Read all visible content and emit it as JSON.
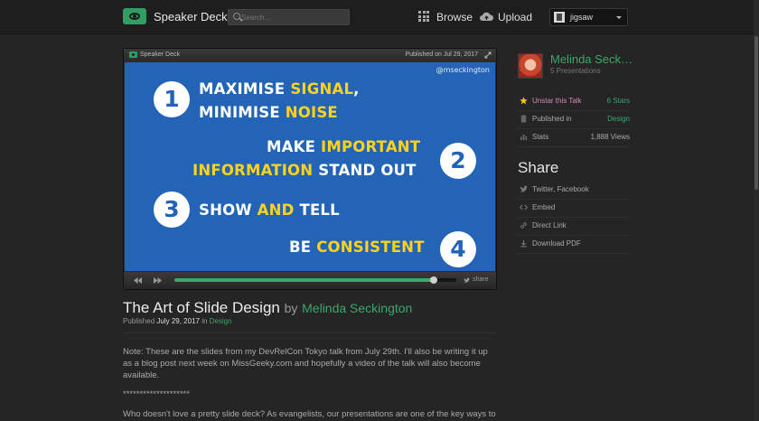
{
  "header": {
    "brand": "Speaker Deck",
    "search_placeholder": "Search...",
    "browse": "Browse",
    "upload": "Upload",
    "username": "jigsaw"
  },
  "player": {
    "brand": "Speaker Deck",
    "published": "Published on Jul 29, 2017",
    "share": "share",
    "progress": 0.92
  },
  "slide": {
    "handle": "@mseckington",
    "num1": "1",
    "line1a": "MAXIMISE ",
    "line1b": "SIGNAL",
    "line1c": ",",
    "line2a": "MINIMISE ",
    "line2b": "NOISE",
    "num2": "2",
    "line3a": "MAKE ",
    "line3b": "IMPORTANT",
    "line4a": "INFORMATION",
    "line4b": " STAND OUT",
    "num3": "3",
    "line5a": "SHOW ",
    "line5b": "AND",
    "line5c": " TELL",
    "num4": "4",
    "line6a": "BE ",
    "line6b": "CONSISTENT"
  },
  "talk": {
    "title": "The Art of Slide Design",
    "by": "by",
    "author": "Melinda Seckington",
    "published_prefix": "Published",
    "published_date": "July 29, 2017",
    "published_in": "in",
    "category": "Design",
    "desc1": "Note: These are the slides from my DevRelCon Tokyo talk from July 29th. I'll also be writing it up as a blog post next week on MissGeeky.com and hopefully a video of the talk will also become available.",
    "desc2": "********************",
    "desc3": "Who doesn't love a pretty slide deck? As evangelists, our presentations are one of the key ways to"
  },
  "sidebar": {
    "author_name": "Melinda Seck…",
    "presentations": "5 Presentations",
    "unstar": "Unstar this Talk",
    "stars": "6 Stars",
    "published_in": "Published in",
    "category": "Design",
    "stats": "Stats",
    "views": "1,888 Views",
    "share_heading": "Share",
    "twitter_facebook": "Twitter, Facebook",
    "embed": "Embed",
    "direct_link": "Direct Link",
    "download_pdf": "Download PDF"
  },
  "colors": {
    "accent": "#3aa86a",
    "slide_bg": "#2364b6",
    "slide_highlight": "#ffd21e",
    "background": "#252525"
  }
}
